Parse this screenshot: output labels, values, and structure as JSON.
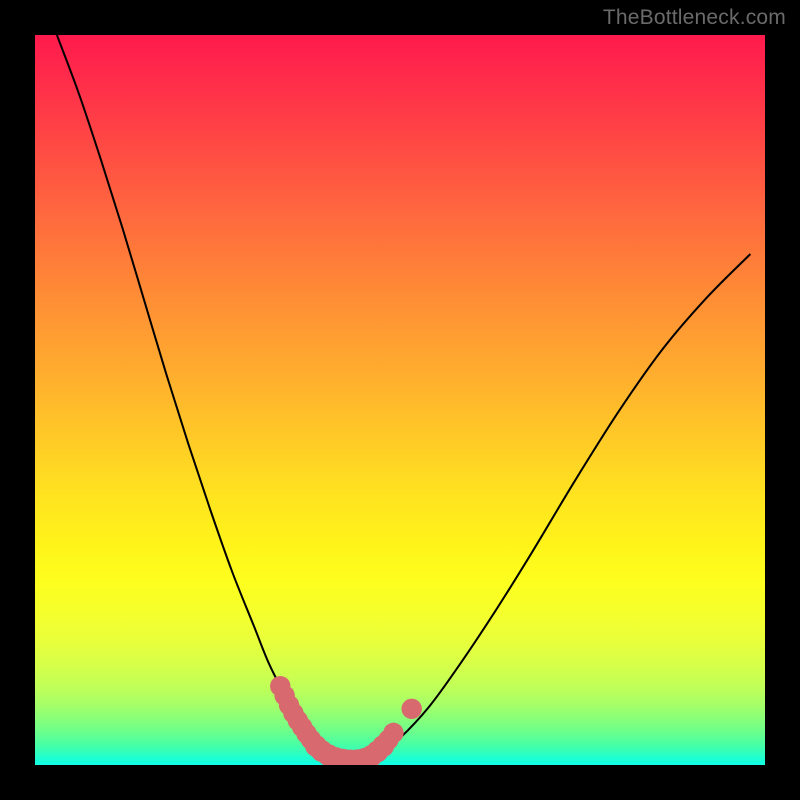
{
  "watermark": "TheBottleneck.com",
  "colors": {
    "frame": "#000000",
    "curve": "#000000",
    "markers": "#d86a6f",
    "gradient_top": "#ff1a4d",
    "gradient_mid": "#fff41a",
    "gradient_bottom": "#10ffe6"
  },
  "chart_data": {
    "type": "line",
    "title": "",
    "xlabel": "",
    "ylabel": "",
    "xlim": [
      0,
      100
    ],
    "ylim": [
      0,
      100
    ],
    "grid": false,
    "legend_position": "none",
    "series": [
      {
        "name": "bottleneck-curve",
        "x": [
          3,
          6,
          9,
          12,
          15,
          18,
          21,
          24,
          27,
          30,
          32,
          34,
          36,
          37.5,
          39,
          41,
          43,
          45,
          47,
          50,
          54,
          58,
          63,
          68,
          74,
          80,
          86,
          92,
          98
        ],
        "values": [
          100,
          92,
          83,
          73.5,
          63.5,
          53.5,
          44,
          35,
          26.5,
          19,
          14,
          10,
          6.2,
          3.8,
          2,
          0.9,
          0.6,
          0.6,
          1.4,
          3.7,
          8,
          13.5,
          21,
          29,
          39,
          48.5,
          57,
          64,
          70
        ]
      }
    ],
    "markers": [
      {
        "x": 33.6,
        "y": 10.8,
        "r": 1.4
      },
      {
        "x": 34.2,
        "y": 9.5,
        "r": 1.4
      },
      {
        "x": 34.8,
        "y": 8.2,
        "r": 1.4
      },
      {
        "x": 35.4,
        "y": 7.1,
        "r": 1.4
      },
      {
        "x": 36.0,
        "y": 6.1,
        "r": 1.4
      },
      {
        "x": 36.6,
        "y": 5.2,
        "r": 1.4
      },
      {
        "x": 37.2,
        "y": 4.3,
        "r": 1.4
      },
      {
        "x": 37.8,
        "y": 3.5,
        "r": 1.4
      },
      {
        "x": 38.5,
        "y": 2.6,
        "r": 1.5
      },
      {
        "x": 39.3,
        "y": 1.9,
        "r": 1.5
      },
      {
        "x": 40.2,
        "y": 1.35,
        "r": 1.5
      },
      {
        "x": 41.2,
        "y": 0.95,
        "r": 1.5
      },
      {
        "x": 42.2,
        "y": 0.73,
        "r": 1.5
      },
      {
        "x": 43.2,
        "y": 0.62,
        "r": 1.5
      },
      {
        "x": 44.2,
        "y": 0.65,
        "r": 1.5
      },
      {
        "x": 45.2,
        "y": 0.85,
        "r": 1.5
      },
      {
        "x": 46.1,
        "y": 1.25,
        "r": 1.5
      },
      {
        "x": 46.9,
        "y": 1.85,
        "r": 1.5
      },
      {
        "x": 47.7,
        "y": 2.6,
        "r": 1.5
      },
      {
        "x": 48.4,
        "y": 3.45,
        "r": 1.4
      },
      {
        "x": 49.1,
        "y": 4.4,
        "r": 1.4
      },
      {
        "x": 51.6,
        "y": 7.7,
        "r": 1.4
      }
    ]
  }
}
